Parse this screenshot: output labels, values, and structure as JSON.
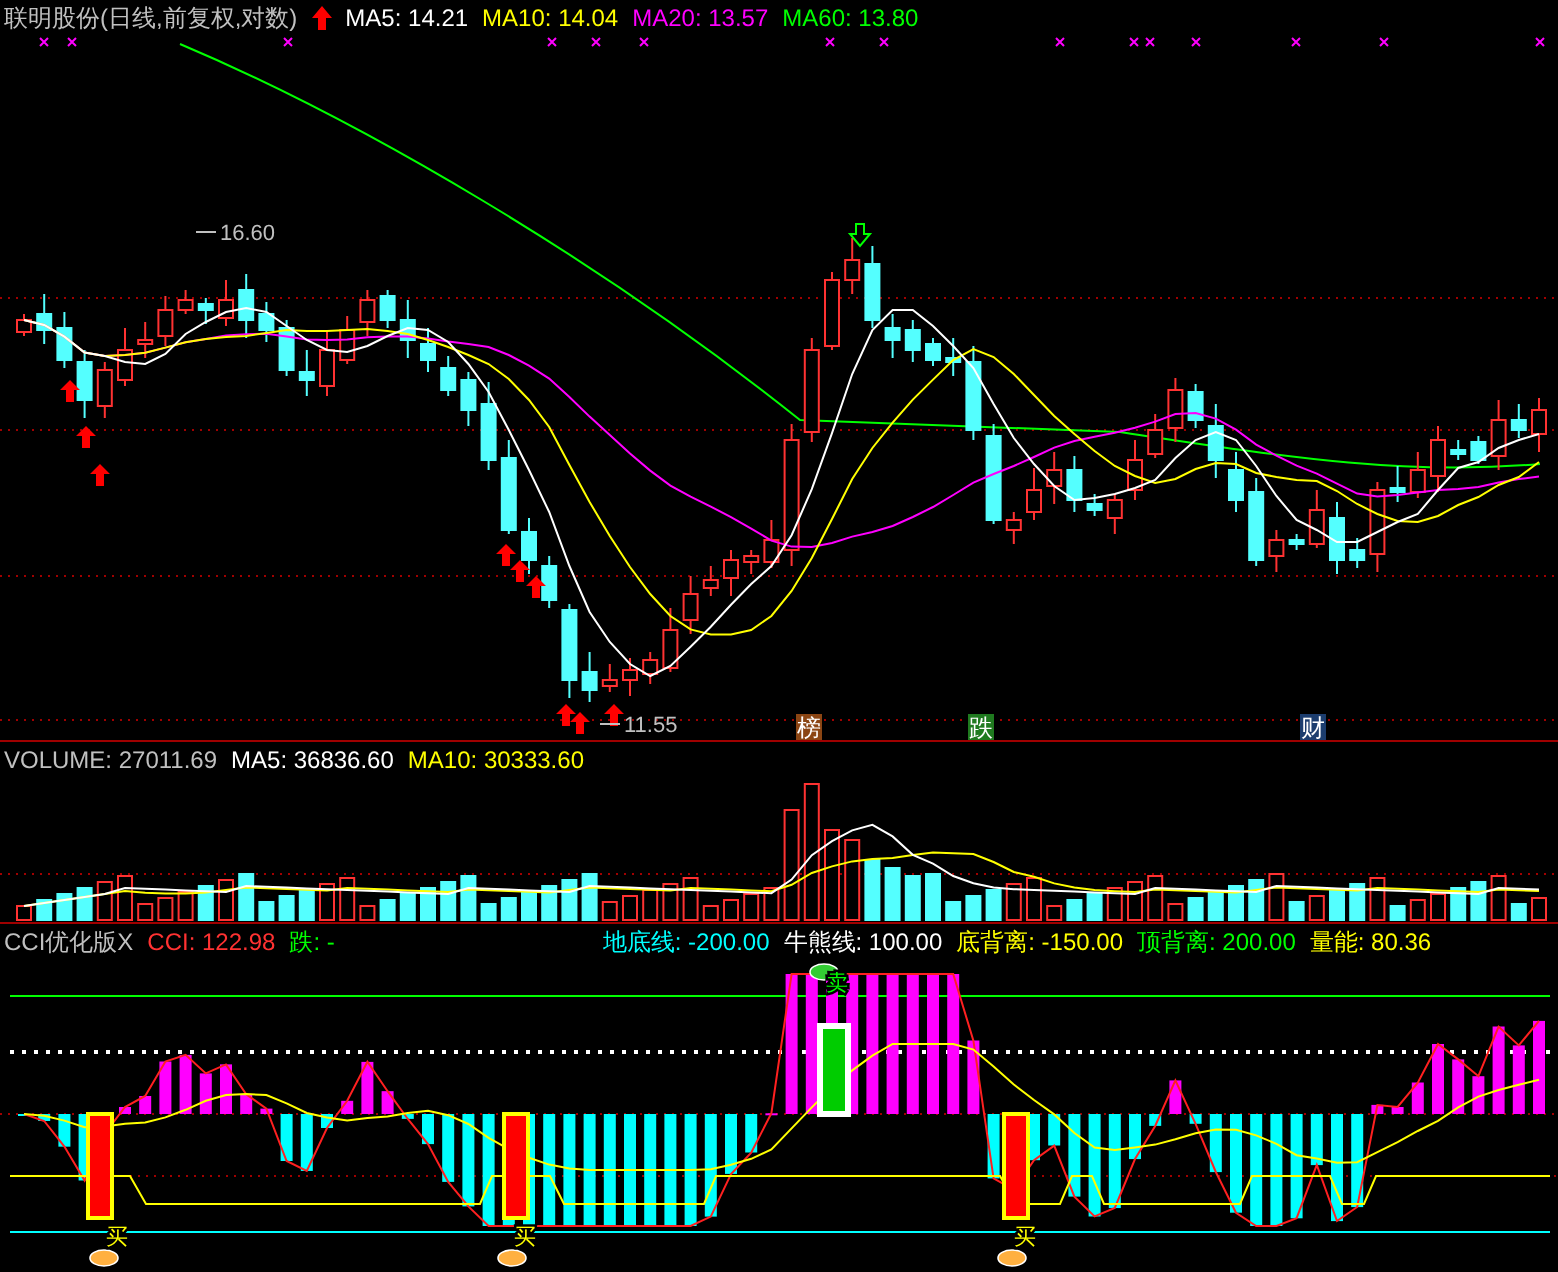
{
  "main_chart": {
    "title": "联明股份(日线,前复权,对数)",
    "indicators": [
      {
        "label": "MA5: 14.21",
        "color": "#ffffff"
      },
      {
        "label": "MA10: 14.04",
        "color": "#ffff00"
      },
      {
        "label": "MA20: 13.57",
        "color": "#ff00ff"
      },
      {
        "label": "MA60: 13.80",
        "color": "#00ff00"
      }
    ],
    "price_labels": [
      {
        "text": "16.60"
      },
      {
        "text": "11.55"
      }
    ],
    "event_tags": [
      {
        "text": "榜",
        "color": "#8b4513"
      },
      {
        "text": "跌",
        "color": "#1f7a1f"
      },
      {
        "text": "财",
        "color": "#1c3d6e"
      }
    ]
  },
  "volume_panel": {
    "title": "VOLUME: 27011.69",
    "indicators": [
      {
        "label": "MA5: 36836.60",
        "color": "#ffffff"
      },
      {
        "label": "MA10: 30333.60",
        "color": "#ffff00"
      }
    ]
  },
  "cci_panel": {
    "title": "CCI优化版X",
    "indicators": [
      {
        "label": "CCI: 122.98",
        "color": "#ff3232"
      },
      {
        "label": "跌: -",
        "color": "#00ff00"
      }
    ],
    "levels": [
      {
        "label": "地底线: -200.00",
        "color": "#00ffff"
      },
      {
        "label": "牛熊线: 100.00",
        "color": "#ffffff"
      },
      {
        "label": "底背离: -150.00",
        "color": "#ffff00"
      },
      {
        "label": "顶背离: 200.00",
        "color": "#00ff00"
      },
      {
        "label": "量能: 80.36",
        "color": "#ffff00"
      }
    ],
    "signals": [
      {
        "kind": "sell",
        "text": "卖"
      },
      {
        "kind": "buy",
        "text": "买"
      },
      {
        "kind": "buy",
        "text": "买"
      },
      {
        "kind": "buy",
        "text": "买"
      }
    ]
  }
}
